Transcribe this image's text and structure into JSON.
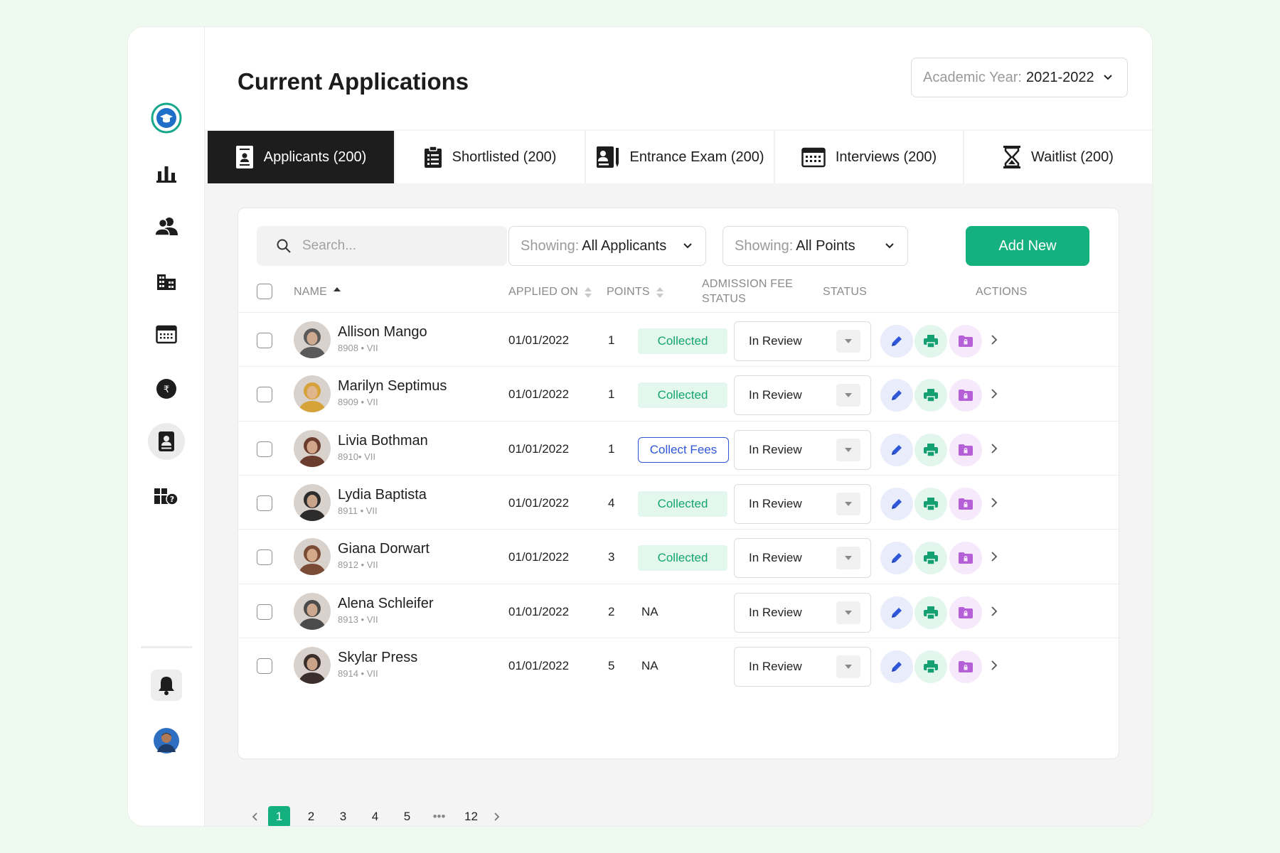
{
  "page": {
    "title": "Current Applications"
  },
  "academic_year": {
    "label": "Academic Year:",
    "value": "2021-2022"
  },
  "sidebar": {
    "items": [
      {
        "name": "logo",
        "icon": "graduation-cap-icon"
      },
      {
        "name": "dashboard",
        "icon": "bar-chart-icon"
      },
      {
        "name": "users",
        "icon": "users-icon"
      },
      {
        "name": "buildings",
        "icon": "building-icon"
      },
      {
        "name": "calendar",
        "icon": "calendar-icon"
      },
      {
        "name": "fees",
        "icon": "rupee-icon"
      },
      {
        "name": "applications",
        "icon": "id-card-icon",
        "active": true
      },
      {
        "name": "help",
        "icon": "help-icon"
      }
    ]
  },
  "tabs": [
    {
      "label": "Applicants (200)",
      "icon": "applicant-doc-icon"
    },
    {
      "label": "Shortlisted (200)",
      "icon": "clipboard-icon"
    },
    {
      "label": "Entrance Exam (200)",
      "icon": "exam-icon"
    },
    {
      "label": "Interviews (200)",
      "icon": "calendar-icon"
    },
    {
      "label": "Waitlist (200)",
      "icon": "hourglass-icon"
    }
  ],
  "toolbar": {
    "search_placeholder": "Search...",
    "filter_applicants_label": "Showing:",
    "filter_applicants_value": "All Applicants",
    "filter_points_label": "Showing:",
    "filter_points_value": "All Points",
    "add_label": "Add New"
  },
  "table": {
    "headers": {
      "name": "NAME",
      "applied": "APPLIED ON",
      "points": "POINTS",
      "fee_line1": "ADMISSION FEE",
      "fee_line2": "STATUS",
      "status": "STATUS",
      "actions": "ACTIONS"
    },
    "rows": [
      {
        "name": "Allison Mango",
        "id": "8908 • VII",
        "applied": "01/01/2022",
        "points": "1",
        "fee": "Collected",
        "fee_type": "collected",
        "status": "In Review",
        "avatar_color": "#5a5a5a"
      },
      {
        "name": "Marilyn Septimus",
        "id": "8909 • VII",
        "applied": "01/01/2022",
        "points": "1",
        "fee": "Collected",
        "fee_type": "collected",
        "status": "In Review",
        "avatar_color": "#d6a23a"
      },
      {
        "name": "Livia  Bothman",
        "id": "8910• VII",
        "applied": "01/01/2022",
        "points": "1",
        "fee": "Collect Fees",
        "fee_type": "collect",
        "status": "In Review",
        "avatar_color": "#6b3d2e"
      },
      {
        "name": "Lydia Baptista",
        "id": "8911 • VII",
        "applied": "01/01/2022",
        "points": "4",
        "fee": "Collected",
        "fee_type": "collected",
        "status": "In Review",
        "avatar_color": "#2c2c2c"
      },
      {
        "name": "Giana Dorwart",
        "id": "8912 • VII",
        "applied": "01/01/2022",
        "points": "3",
        "fee": "Collected",
        "fee_type": "collected",
        "status": "In Review",
        "avatar_color": "#7a4b35"
      },
      {
        "name": "Alena Schleifer",
        "id": "8913 • VII",
        "applied": "01/01/2022",
        "points": "2",
        "fee": "NA",
        "fee_type": "na",
        "status": "In Review",
        "avatar_color": "#4b4b4b"
      },
      {
        "name": "Skylar Press",
        "id": "8914 • VII",
        "applied": "01/01/2022",
        "points": "5",
        "fee": "NA",
        "fee_type": "na",
        "status": "In Review",
        "avatar_color": "#3a2f2a"
      }
    ]
  },
  "pagination": {
    "pages": [
      "1",
      "2",
      "3",
      "4",
      "5",
      "•••",
      "12"
    ],
    "current": "1"
  },
  "colors": {
    "accent": "#14b07e",
    "link": "#2f57d8",
    "edit_bg": "#e8ecfb",
    "print_bg": "#e3f6ee",
    "folder_bg": "#f6e9fb"
  }
}
